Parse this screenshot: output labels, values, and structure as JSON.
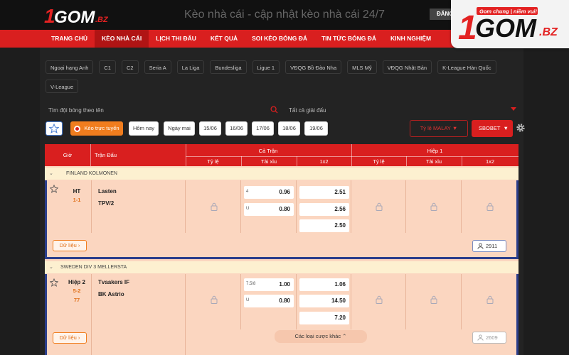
{
  "site_title": "Kèo nhà cái - cập nhật kèo nhà cái 24/7",
  "login_label": "ĐĂNG",
  "logo": {
    "brand": "1GOM",
    "tld": ".BZ",
    "slogan": "Gom chung | niềm vui!"
  },
  "nav": [
    "TRANG CHỦ",
    "KÈO NHÀ CÁI",
    "LỊCH THI ĐẤU",
    "KẾT QUẢ",
    "SOI KÈO BÓNG ĐÁ",
    "TIN TỨC BÓNG ĐÁ",
    "KINH NGHIỆM"
  ],
  "nav_active": 1,
  "leagues": [
    "Ngoại hạng Anh",
    "C1",
    "C2",
    "Seria A",
    "La Liga",
    "Bundesliga",
    "Ligue 1",
    "VĐQG Bồ Đào Nha",
    "MLS Mỹ",
    "VĐQG Nhật Bản",
    "K-League Hàn Quốc",
    "V-League"
  ],
  "search": {
    "placeholder": "Tìm đội bóng theo tên",
    "tournament": "Tất cả giải đấu"
  },
  "filters": {
    "live": "Kèo trực tuyến",
    "today": "Hôm nay",
    "tomorrow": "Ngày mai",
    "dates": [
      "15/06",
      "16/06",
      "17/06",
      "18/06",
      "19/06"
    ],
    "odds_type": "Tỷ lệ MALAY",
    "bookmaker": "SBOBET"
  },
  "table_header": {
    "time": "Giờ",
    "match": "Trận Đấu",
    "full": "Cả Trận",
    "half": "Hiệp 1",
    "cols": [
      "Tỷ lệ",
      "Tài xỉu",
      "1x2"
    ]
  },
  "groups": [
    {
      "league": "FINLAND KOLMONEN",
      "time": "HT",
      "score": "1-1",
      "minute": "",
      "home": "Lasten",
      "away": "TPV/2",
      "ou": [
        {
          "hc": "4",
          "val": "0.96"
        },
        {
          "hc": "U",
          "val": "0.80"
        }
      ],
      "x12": [
        "2.51",
        "2.56",
        "2.50"
      ],
      "data_label": "Dữ liệu",
      "count": "2911"
    },
    {
      "league": "SWEDEN DIV 3 MELLERSTA",
      "time": "Hiệp 2",
      "score": "5-2",
      "minute": "77",
      "home": "Tvaakers IF",
      "away": "BK Astrio",
      "ou": [
        {
          "hc": "7.5/8",
          "val": "1.00"
        },
        {
          "hc": "U",
          "val": "0.80"
        }
      ],
      "x12": [
        "1.06",
        "14.50",
        "7.20"
      ],
      "data_label": "Dữ liệu",
      "count": "2609"
    }
  ],
  "more_bets": "Các loại cược khác"
}
